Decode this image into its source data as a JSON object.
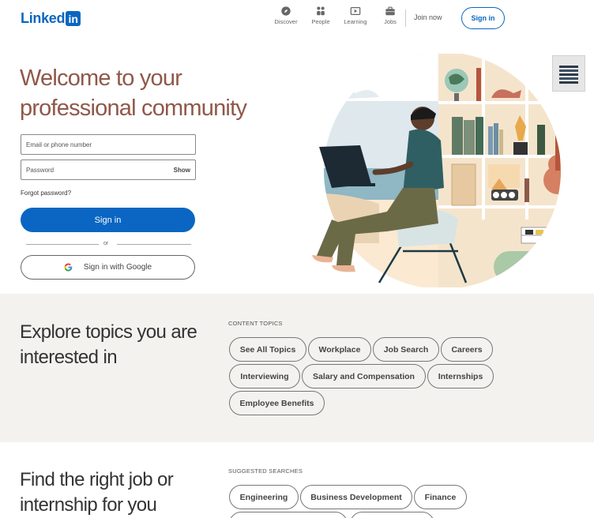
{
  "header": {
    "logo_text": "Linked",
    "logo_box": "in",
    "nav": [
      {
        "label": "Discover",
        "icon": "compass-icon"
      },
      {
        "label": "People",
        "icon": "people-icon"
      },
      {
        "label": "Learning",
        "icon": "play-icon"
      },
      {
        "label": "Jobs",
        "icon": "briefcase-icon"
      }
    ],
    "join_now": "Join now",
    "sign_in": "Sign in"
  },
  "hero": {
    "title": "Welcome to your professional community",
    "email_placeholder": "Email or phone number",
    "password_placeholder": "Password",
    "show_label": "Show",
    "forgot_password": "Forgot password?",
    "sign_in_button": "Sign in",
    "or_text": "or",
    "google_button": "Sign in with Google"
  },
  "topics": {
    "title": "Explore topics you are interested in",
    "label": "CONTENT TOPICS",
    "pills": [
      "See All Topics",
      "Workplace",
      "Job Search",
      "Careers",
      "Interviewing",
      "Salary and Compensation",
      "Internships",
      "Employee Benefits"
    ]
  },
  "jobs": {
    "title": "Find the right job or internship for you",
    "label": "SUGGESTED SEARCHES",
    "pills": [
      "Engineering",
      "Business Development",
      "Finance"
    ]
  },
  "colors": {
    "brand": "#0a66c2",
    "hero_title": "#8f5849",
    "section_bg": "#f3f2ef"
  }
}
